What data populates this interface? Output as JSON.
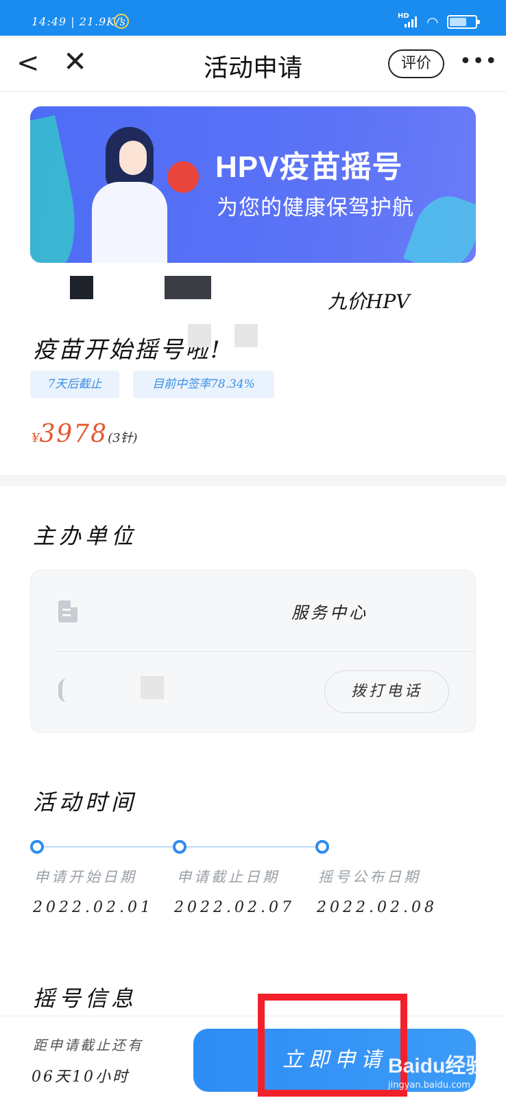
{
  "status_bar": {
    "time": "14:49 | 21.9K/s",
    "hd": "HD"
  },
  "nav": {
    "back_icon": "<",
    "close_icon": "✕",
    "title": "活动申请",
    "rate_label": "评价",
    "more_icon": "•••"
  },
  "banner": {
    "headline": "HPV疫苗摇号",
    "subline": "为您的健康保驾护航"
  },
  "activity": {
    "title_line1": "九价HPV",
    "title_line2": "疫苗开始摇号啦!",
    "tags": [
      "7天后截止",
      "目前中签率78.34%"
    ],
    "price_symbol": "¥",
    "price_value": "3978",
    "price_unit": "(3针)"
  },
  "organizer": {
    "section_title": "主办单位",
    "org_name": "服务中心",
    "call_button": "拨打电话"
  },
  "activity_time": {
    "section_title": "活动时间",
    "steps": [
      {
        "label": "申请开始日期",
        "date": "2022.02.01"
      },
      {
        "label": "申请截止日期",
        "date": "2022.02.07"
      },
      {
        "label": "摇号公布日期",
        "date": "2022.02.08"
      }
    ]
  },
  "lottery_info": {
    "section_title": "摇号信息"
  },
  "bottom_bar": {
    "countdown_label": "距申请截止还有",
    "countdown_value": "06天10小时",
    "apply_button": "立即申请"
  },
  "watermark": {
    "main": "Baidu经验",
    "sub": "jingyan.baidu.com"
  },
  "colors": {
    "status_bar": "#1a8cf0",
    "accent": "#2e8df5",
    "price": "#e4572e",
    "tag_text": "#3b8ee6",
    "highlight": "#f2202a"
  }
}
